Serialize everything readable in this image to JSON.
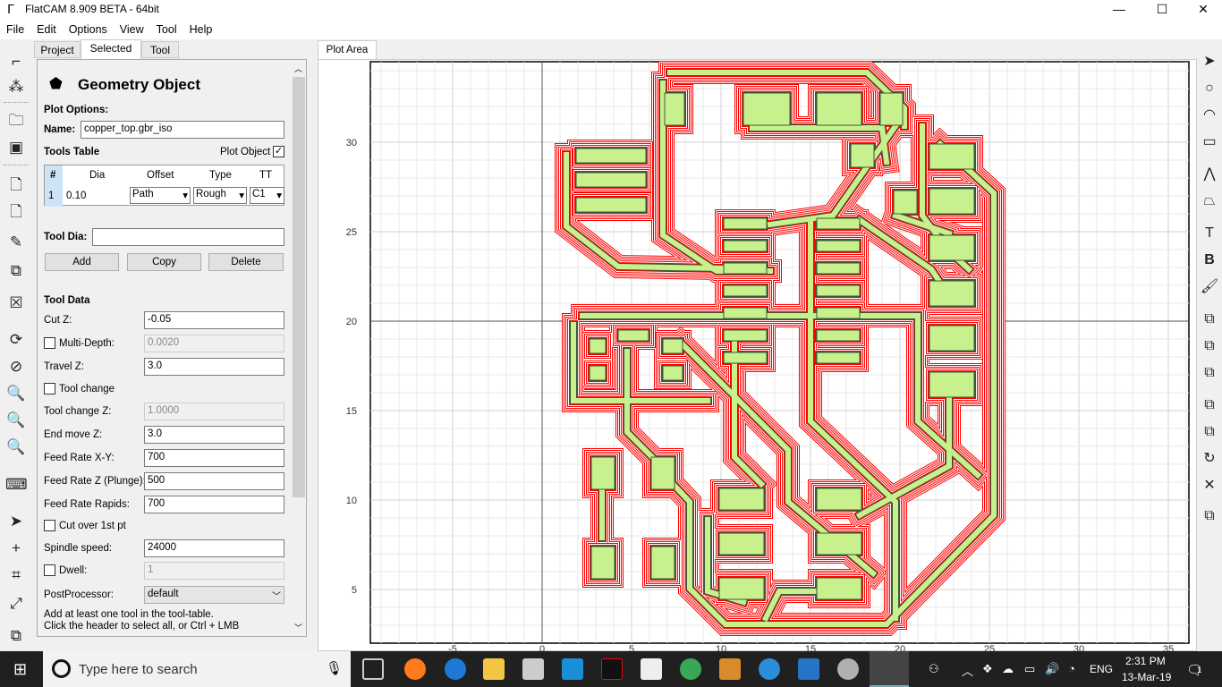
{
  "window": {
    "title": "FlatCAM 8.909 BETA - 64bit",
    "minimize": "—",
    "maximize": "☐",
    "close": "✕"
  },
  "menu": [
    "File",
    "Edit",
    "Options",
    "View",
    "Tool",
    "Help"
  ],
  "tabs": [
    "Project",
    "Selected",
    "Tool"
  ],
  "panel": {
    "title": "Geometry Object",
    "plot_options": "Plot Options:",
    "name_label": "Name:",
    "name_value": "copper_top.gbr_iso",
    "tools_table": "Tools Table",
    "plot_object": "Plot Object",
    "plot_object_checked": true,
    "table_headers": [
      "#",
      "Dia",
      "Offset",
      "Type",
      "TT"
    ],
    "table_rows": [
      {
        "num": "1",
        "dia": "0.10",
        "offset": "Path",
        "type": "Rough",
        "tt": "C1"
      }
    ],
    "tool_dia_label": "Tool Dia:",
    "tool_dia_value": "",
    "add": "Add",
    "copy": "Copy",
    "delete": "Delete",
    "tool_data": "Tool Data",
    "cut_z_label": "Cut Z:",
    "cut_z": "-0.05",
    "multi_depth_label": "Multi-Depth:",
    "multi_depth": "0.0020",
    "travel_z_label": "Travel Z:",
    "travel_z": "3.0",
    "tool_change_label": "Tool change",
    "tool_change_z_label": "Tool change Z:",
    "tool_change_z": "1.0000",
    "end_move_z_label": "End move Z:",
    "end_move_z": "3.0",
    "feed_xy_label": "Feed Rate X-Y:",
    "feed_xy": "700",
    "feed_z_label": "Feed Rate Z (Plunge):",
    "feed_z": "500",
    "feed_rapids_label": "Feed Rate Rapids:",
    "feed_rapids": "700",
    "cut_over_label": "Cut over 1st pt",
    "spindle_label": "Spindle speed:",
    "spindle": "24000",
    "dwell_label": "Dwell:",
    "dwell": "1",
    "post_label": "PostProcessor:",
    "post": "default",
    "hint1": "Add at least one tool in the tool-table.",
    "hint2": "Click the header to select all, or Ctrl + LMB"
  },
  "plot": {
    "tab": "Plot Area",
    "x_ticks": [
      "-5",
      "0",
      "5",
      "10",
      "15",
      "20",
      "25",
      "30",
      "35"
    ],
    "y_ticks": [
      "5",
      "10",
      "15",
      "20",
      "25",
      "30"
    ],
    "colors": {
      "outline": "#ff0000",
      "copper": "#c8f08c",
      "grid": "#e8e8e8"
    }
  },
  "taskbar": {
    "search_placeholder": "Type here to search",
    "time": "2:31 PM",
    "date": "13-Mar-19",
    "lang": "ENG",
    "notifications": "1"
  }
}
